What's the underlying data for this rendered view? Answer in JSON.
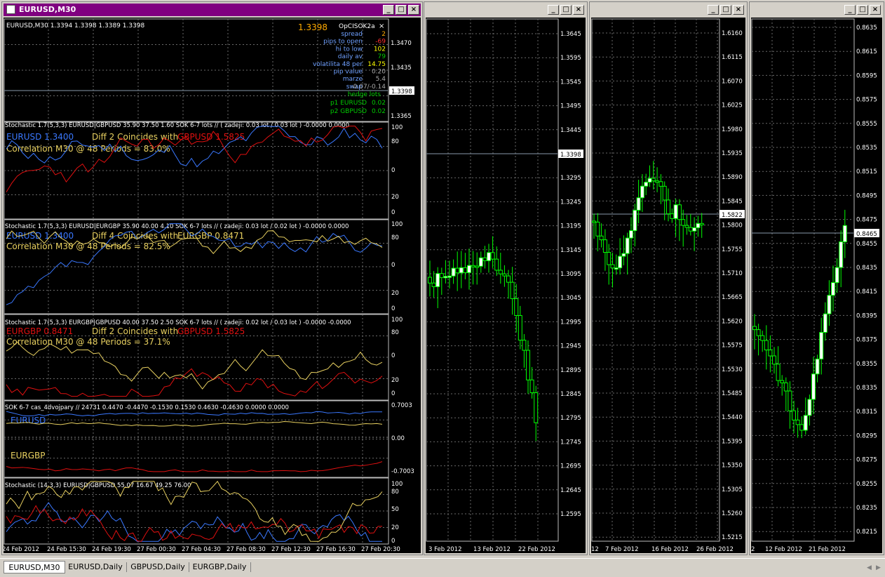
{
  "windows": [
    {
      "title": "EURUSD,M30",
      "active": true
    },
    {
      "title": "",
      "active": false
    },
    {
      "title": "",
      "active": false
    },
    {
      "title": "",
      "active": false
    }
  ],
  "win1": {
    "main": {
      "header": "EURUSD,M30  1.3394 1.3398 1.3389 1.3398",
      "bigprice": "1.3398",
      "panel_title": "OpCISOK2a",
      "panel_close": "×",
      "info": [
        {
          "label": "spread",
          "value": "2",
          "color": "#ffaa00"
        },
        {
          "label": "pips to open",
          "value": "-69",
          "color": "#ff3030"
        },
        {
          "label": "hi to low",
          "value": "102",
          "color": "#ffff00"
        },
        {
          "label": "daily av",
          "value": "79",
          "color": "#00cc00"
        },
        {
          "label": "volatilita 48 per",
          "value": "14.75",
          "color": "#ffff00"
        },
        {
          "label": "pip value",
          "value": "0.20",
          "color": "#aaaaaa"
        },
        {
          "label": "marze",
          "value": "5.4",
          "color": "#aaaaaa"
        },
        {
          "label": "swap",
          "value": "-0.07/-0.14",
          "color": "#aaaaaa"
        }
      ],
      "hedge_label": "hedge lots",
      "hedge": [
        {
          "label": "p1 EURUSD",
          "value": "0.02"
        },
        {
          "label": "p2 GBPUSD",
          "value": "0.02"
        }
      ],
      "axis": [
        "1.3470",
        "1.3435",
        "1.3365"
      ],
      "price_box": "1.3398"
    },
    "stoch1": {
      "header": "Stochastic 1.7(5,3,3) EURUSD|GBPUSD 35.90 37.50 1.60  SOK 6-7 lots  // ( zadeji: 0.03 lot / 0.03 lot ) -0.0000 0.0000",
      "l1a": "EURUSD 1.3400",
      "l1b": "Diff 2 Coincides with",
      "l1c": "GBPUSD 1.5825",
      "l2": "Correlation M30 @ 48 Periods = 83.0%",
      "axis": [
        "100",
        "80",
        "0",
        "20",
        "0"
      ]
    },
    "stoch2": {
      "header": "Stochastic 1.7(5,3,3) EURUSD|EURGBP 35.90 40.00 4.10  SOK 6-7 lots  // ( zadeji: 0.03 lot / 0.02 lot ) -0.0000 0.0000",
      "l1a": "EURUSD 1.3400",
      "l1b": "Diff 4 Coincides with",
      "l1c": "EURGBP 0.8471",
      "l2": "Correlation M30 @ 48 Periods = 82.5%",
      "axis": [
        "100",
        "80",
        "0",
        "20",
        "0"
      ]
    },
    "stoch3": {
      "header": "Stochastic 1.7(5,3,3) EURGBP|GBPUSD 40.00 37.50 2.50  SOK 6-7 lots  // ( zadeji: 0.02 lot / 0.03 lot ) -0.0000 -0.0000",
      "l1a": "EURGBP 0.8471",
      "l1b": "Diff 2 Coincides with",
      "l1c": "GBPUSD 1.5825",
      "l2": "Correlation M30 @ 48 Periods = 37.1%",
      "axis": [
        "100",
        "80",
        "0",
        "20",
        "0"
      ]
    },
    "sok": {
      "header": "SOK 6-7 cas_4dvojpary  //  24731 0.4470 -0.4470 -0.1530 0.1530 0.4630 -0.4630 0.0000 0.0000",
      "label1": "EURUSD",
      "label2": "EURGBP",
      "axis": [
        "0.7003",
        "0.00",
        "-0.7003"
      ]
    },
    "stoch4": {
      "header": "Stochastic (14,3,3) EURUSD|GBPUSD 55.07 16.67 49.25 76.00",
      "axis": [
        "100",
        "80",
        "50",
        "20",
        "0"
      ]
    },
    "time_axis": [
      "24 Feb 2012",
      "24 Feb 15:30",
      "24 Feb 19:30",
      "27 Feb 00:30",
      "27 Feb 04:30",
      "27 Feb 08:30",
      "27 Feb 12:30",
      "27 Feb 16:30",
      "27 Feb 20:30"
    ]
  },
  "win2": {
    "axis": [
      "1.3645",
      "1.3595",
      "1.3545",
      "1.3495",
      "1.3445",
      "1.3345",
      "1.3295",
      "1.3245",
      "1.3195",
      "1.3145",
      "1.3095",
      "1.3045",
      "1.2995",
      "1.2945",
      "1.2895",
      "1.2845",
      "1.2795",
      "1.2745",
      "1.2695",
      "1.2645",
      "1.2595"
    ],
    "price_box": "1.3398",
    "time_axis": [
      "3 Feb 2012",
      "13 Feb 2012",
      "22 Feb 2012"
    ]
  },
  "win3": {
    "axis": [
      "1.6160",
      "1.6115",
      "1.6070",
      "1.6025",
      "1.5980",
      "1.5935",
      "1.5890",
      "1.5845",
      "1.5800",
      "1.5755",
      "1.5710",
      "1.5665",
      "1.5620",
      "1.5575",
      "1.5530",
      "1.5485",
      "1.5440",
      "1.5395",
      "1.5350",
      "1.5305",
      "1.5260",
      "1.5215"
    ],
    "price_box": "1.5822",
    "time_axis": [
      "12",
      "7 Feb 2012",
      "16 Feb 2012",
      "26 Feb 2012"
    ]
  },
  "win4": {
    "axis": [
      "0.8635",
      "0.8615",
      "0.8595",
      "0.8575",
      "0.8555",
      "0.8535",
      "0.8515",
      "0.8495",
      "0.8475",
      "0.8455",
      "0.8435",
      "0.8415",
      "0.8395",
      "0.8375",
      "0.8355",
      "0.8335",
      "0.8315",
      "0.8295",
      "0.8275",
      "0.8255",
      "0.8235",
      "0.8215"
    ],
    "price_box": "0.8465",
    "time_axis": [
      "2",
      "12 Feb 2012",
      "21 Feb 2012"
    ]
  },
  "tabs": [
    "EURUSD,M30",
    "EURUSD,Daily",
    "GBPUSD,Daily",
    "EURGBP,Daily"
  ],
  "colors": {
    "blue": "#3a78ff",
    "red": "#e01010",
    "yellow": "#e8d060",
    "candle": "#00ff00",
    "grid": "#6a6a6a"
  }
}
